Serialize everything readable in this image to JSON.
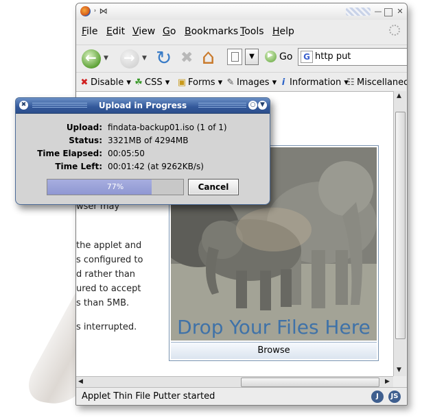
{
  "menubar": {
    "items": [
      {
        "label": "File",
        "key": "F",
        "rest": "ile"
      },
      {
        "label": "Edit",
        "key": "E",
        "rest": "dit"
      },
      {
        "label": "View",
        "key": "V",
        "rest": "iew"
      },
      {
        "label": "Go",
        "key": "G",
        "rest": "o"
      },
      {
        "label": "Bookmarks",
        "key": "B",
        "rest": "ookmarks"
      },
      {
        "label": "Tools",
        "key": "T",
        "rest": "ools"
      },
      {
        "label": "Help",
        "key": "H",
        "rest": "elp"
      }
    ]
  },
  "navbar": {
    "go_label": "Go",
    "search_value": "http put",
    "search_engine_letter": "G"
  },
  "devbar": {
    "items": [
      {
        "label": "Disable",
        "icon": "disable-icon"
      },
      {
        "label": "CSS",
        "icon": "css-icon"
      },
      {
        "label": "Forms",
        "icon": "forms-lock-icon"
      },
      {
        "label": "Images",
        "icon": "images-icon"
      },
      {
        "label": "Information",
        "icon": "information-icon"
      },
      {
        "label": "Miscellaneo",
        "icon": "miscellaneous-icon"
      }
    ]
  },
  "page": {
    "lines": [
      "wser may",
      "the applet and",
      "s configured to",
      "d rather than",
      "ured to accept",
      "s than 5MB.",
      "s interrupted."
    ],
    "drop_label": "Drop Your Files Here",
    "browse_label": "Browse"
  },
  "dialog": {
    "title": "Upload in Progress",
    "upload_label": "Upload:",
    "upload_value": "findata-backup01.iso (1 of 1)",
    "status_label": "Status:",
    "status_value": "3321MB of 4294MB",
    "elapsed_label": "Time Elapsed:",
    "elapsed_value": "00:05:50",
    "left_label": "Time Left:",
    "left_value": "00:01:42 (at 9262KB/s)",
    "progress_text": "77%",
    "progress_fraction": 0.77,
    "cancel_label": "Cancel"
  },
  "statusbar": {
    "text": "Applet Thin File Putter started",
    "badge_j": "J",
    "badge_js": "JS"
  },
  "colors": {
    "dialog_title": "#33589a",
    "progress_fill": "#8f97d2",
    "drop_label": "#3f72a8"
  }
}
